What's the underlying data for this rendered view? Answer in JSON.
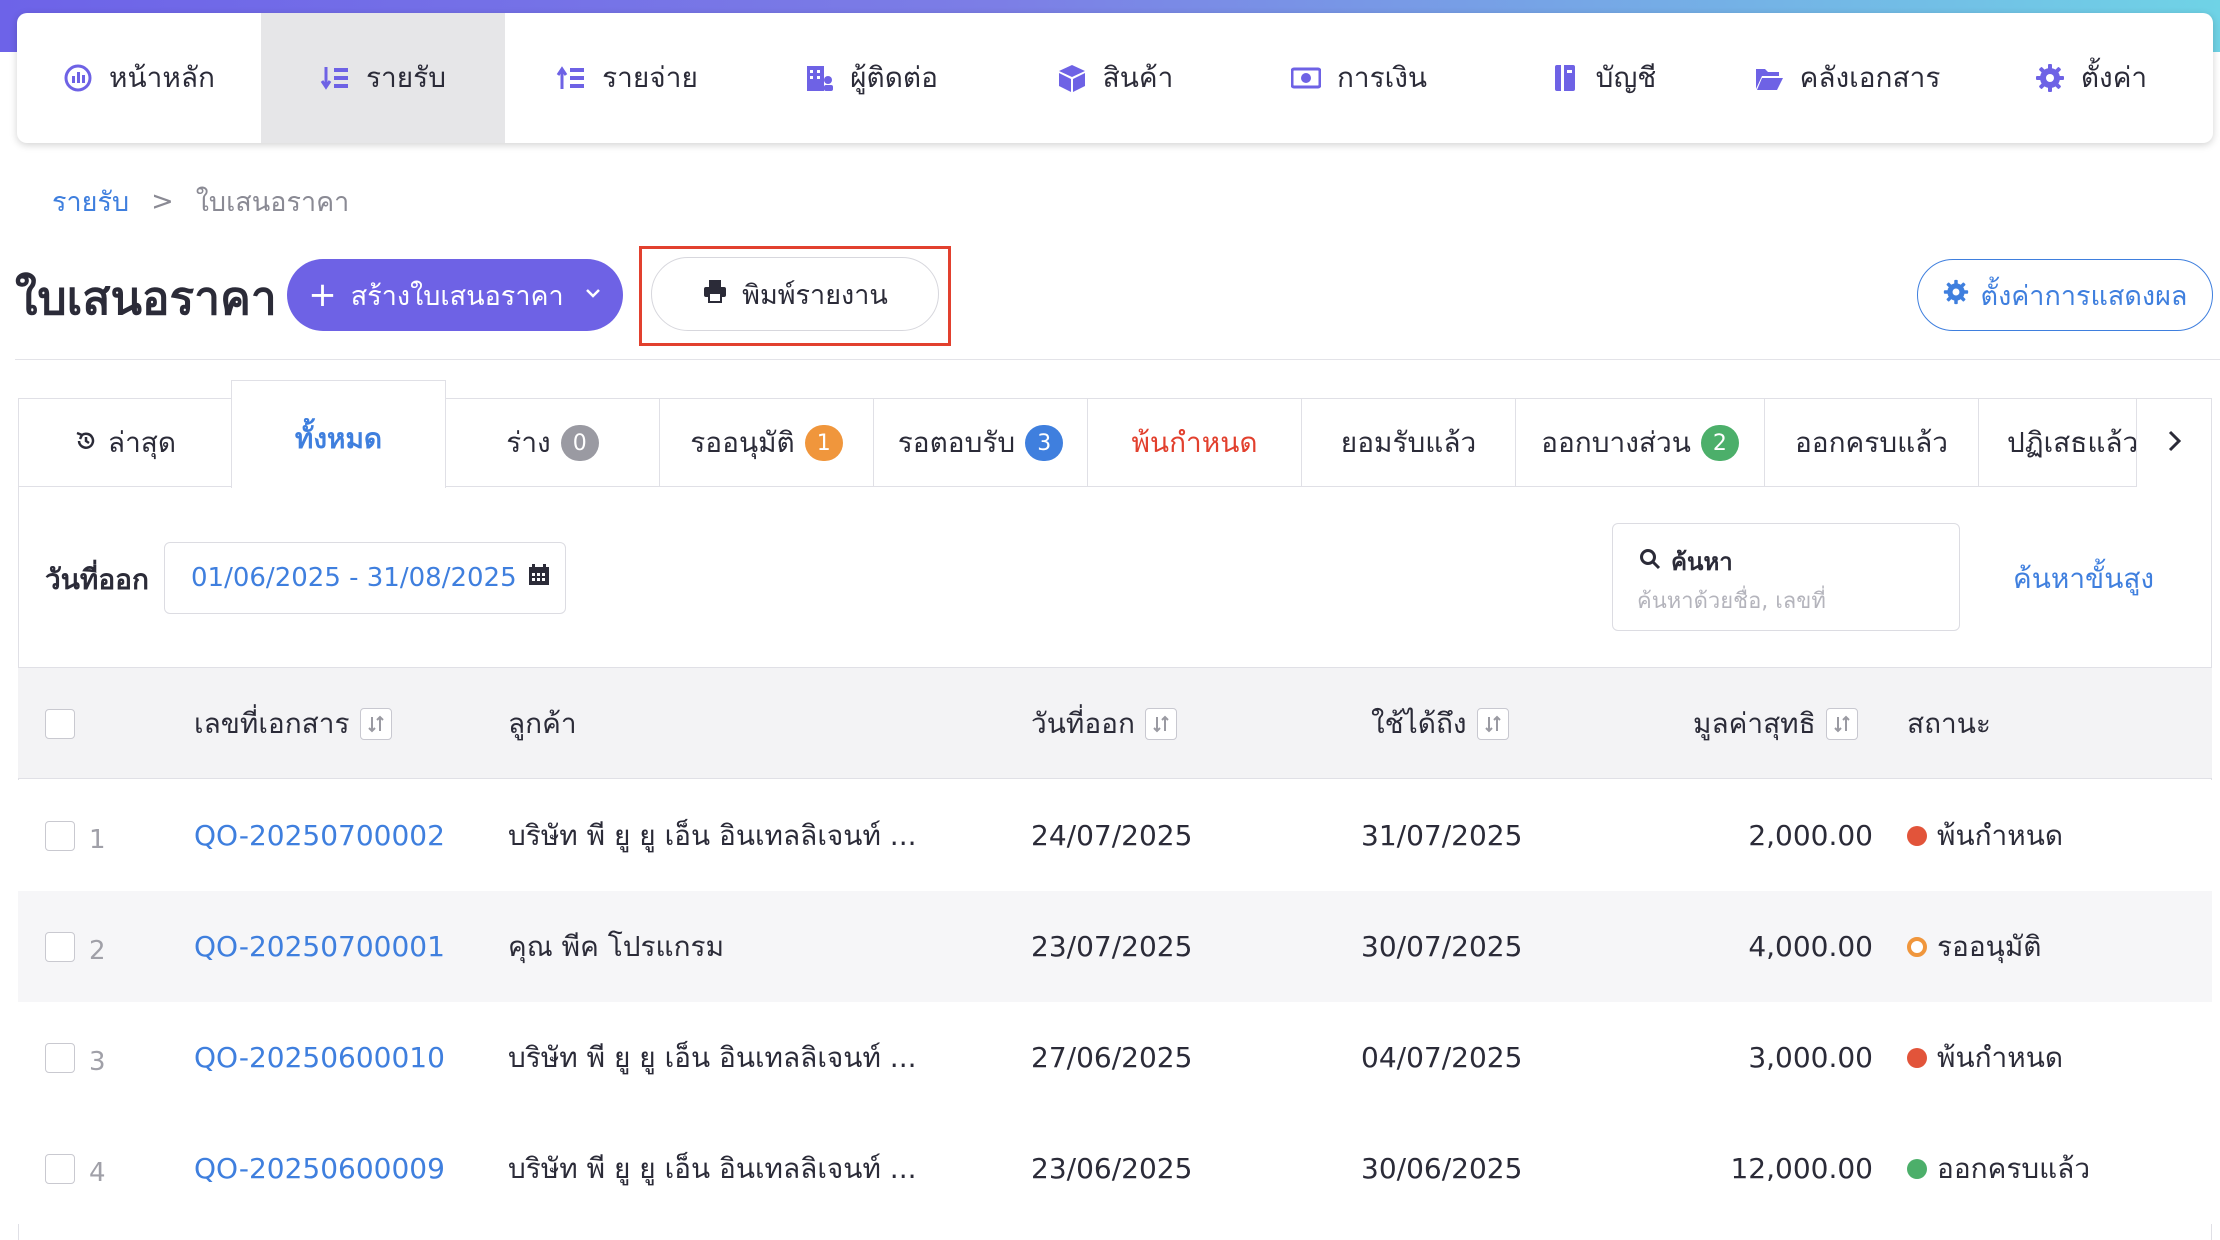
{
  "nav": {
    "items": [
      {
        "label": "หน้าหลัก",
        "icon": "dashboard-icon"
      },
      {
        "label": "รายรับ",
        "icon": "income-list-icon",
        "active": true
      },
      {
        "label": "รายจ่าย",
        "icon": "expense-list-icon"
      },
      {
        "label": "ผู้ติดต่อ",
        "icon": "contacts-building-icon"
      },
      {
        "label": "สินค้า",
        "icon": "product-box-icon"
      },
      {
        "label": "การเงิน",
        "icon": "money-bill-icon"
      },
      {
        "label": "บัญชี",
        "icon": "ledger-book-icon"
      },
      {
        "label": "คลังเอกสาร",
        "icon": "folder-open-icon"
      },
      {
        "label": "ตั้งค่า",
        "icon": "gear-icon"
      }
    ]
  },
  "breadcrumb": {
    "parent": "รายรับ",
    "separator": ">",
    "current": "ใบเสนอราคา"
  },
  "header": {
    "title": "ใบเสนอราคา",
    "create_label": "สร้างใบเสนอราคา",
    "print_label": "พิมพ์รายงาน",
    "display_settings_label": "ตั้งค่าการแสดงผล"
  },
  "tabs": [
    {
      "label": "ล่าสุด",
      "icon": "history-icon"
    },
    {
      "label": "ทั้งหมด",
      "active": true
    },
    {
      "label": "ร่าง",
      "badge": "0",
      "badge_color": "#9a9aa2"
    },
    {
      "label": "รออนุมัติ",
      "badge": "1",
      "badge_color": "#f0963c"
    },
    {
      "label": "รอตอบรับ",
      "badge": "3",
      "badge_color": "#3f7fde"
    },
    {
      "label": "พ้นกำหนด",
      "color": "#e2402e"
    },
    {
      "label": "ยอมรับแล้ว"
    },
    {
      "label": "ออกบางส่วน",
      "badge": "2",
      "badge_color": "#4caf6a"
    },
    {
      "label": "ออกครบแล้ว"
    },
    {
      "label": "ปฏิเสธแล้ว"
    }
  ],
  "filters": {
    "date_label": "วันที่ออก",
    "date_range": "01/06/2025 - 31/08/2025",
    "search_label": "ค้นหา",
    "search_placeholder": "ค้นหาด้วยชื่อ, เลขที่",
    "advanced_search": "ค้นหาขั้นสูง"
  },
  "table": {
    "columns": {
      "doc_no": "เลขที่เอกสาร",
      "customer": "ลูกค้า",
      "issue_date": "วันที่ออก",
      "valid_until": "ใช้ได้ถึง",
      "net_value": "มูลค่าสุทธิ",
      "status": "สถานะ"
    },
    "rows": [
      {
        "num": "1",
        "doc_no": "QO-20250700002",
        "customer": "บริษัท พี ยู ยู เอ็น อินเทลลิเจนท์ ...",
        "issue_date": "24/07/2025",
        "valid_until": "31/07/2025",
        "net_value": "2,000.00",
        "status": "พ้นกำหนด",
        "status_color": "#e2543a",
        "status_style": "filled"
      },
      {
        "num": "2",
        "doc_no": "QO-20250700001",
        "customer": "คุณ พีค โปรแกรม",
        "issue_date": "23/07/2025",
        "valid_until": "30/07/2025",
        "net_value": "4,000.00",
        "status": "รออนุมัติ",
        "status_color": "#f0963c",
        "status_style": "ring"
      },
      {
        "num": "3",
        "doc_no": "QO-20250600010",
        "customer": "บริษัท พี ยู ยู เอ็น อินเทลลิเจนท์ ...",
        "issue_date": "27/06/2025",
        "valid_until": "04/07/2025",
        "net_value": "3,000.00",
        "status": "พ้นกำหนด",
        "status_color": "#e2543a",
        "status_style": "filled"
      },
      {
        "num": "4",
        "doc_no": "QO-20250600009",
        "customer": "บริษัท พี ยู ยู เอ็น อินเทลลิเจนท์ ...",
        "issue_date": "23/06/2025",
        "valid_until": "30/06/2025",
        "net_value": "12,000.00",
        "status": "ออกครบแล้ว",
        "status_color": "#4caf6a",
        "status_style": "filled"
      }
    ]
  },
  "colors": {
    "accent": "#6e62e5",
    "link": "#3f7fde",
    "danger": "#e2402e"
  }
}
